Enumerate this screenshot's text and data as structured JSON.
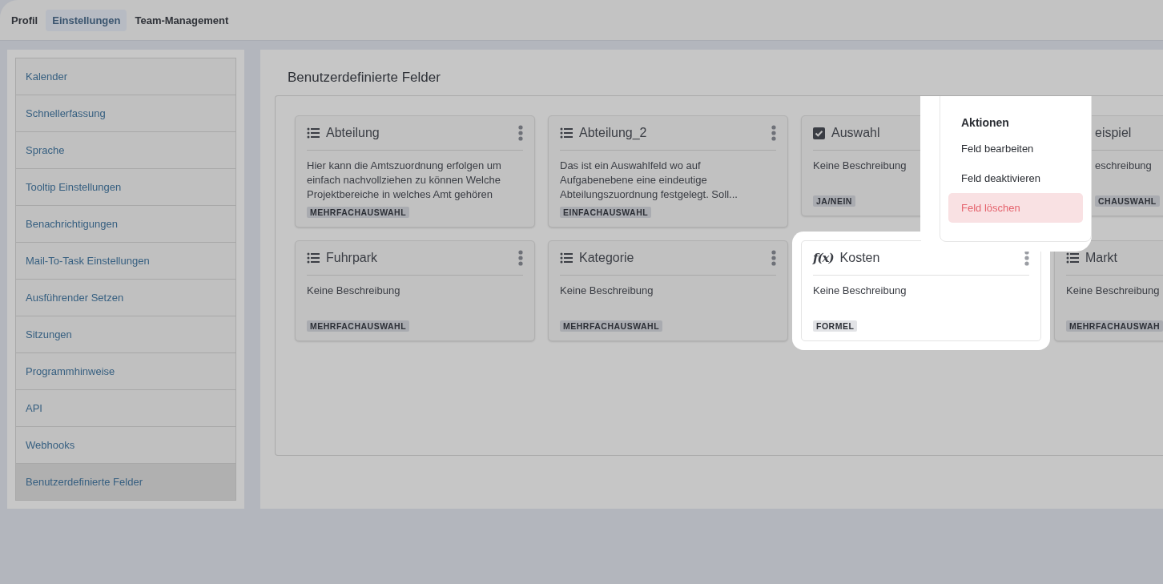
{
  "tabs": [
    {
      "label": "Profil",
      "selected": false
    },
    {
      "label": "Einstellungen",
      "selected": true
    },
    {
      "label": "Team-Management",
      "selected": false
    }
  ],
  "sidebar": {
    "items": [
      {
        "label": "Kalender",
        "selected": false
      },
      {
        "label": "Schnellerfassung",
        "selected": false
      },
      {
        "label": "Sprache",
        "selected": false
      },
      {
        "label": "Tooltip Einstellungen",
        "selected": false
      },
      {
        "label": "Benachrichtigungen",
        "selected": false
      },
      {
        "label": "Mail-To-Task Einstellungen",
        "selected": false
      },
      {
        "label": "Ausführender Setzen",
        "selected": false
      },
      {
        "label": "Sitzungen",
        "selected": false
      },
      {
        "label": "Programmhinweise",
        "selected": false
      },
      {
        "label": "API",
        "selected": false
      },
      {
        "label": "Webhooks",
        "selected": false
      },
      {
        "label": "Benutzerdefinierte Felder",
        "selected": true
      }
    ]
  },
  "section_title": "Benutzerdefinierte Felder",
  "fields": [
    {
      "kind": "list",
      "title": "Abteilung",
      "description": "Hier kann die Amtszuordnung erfolgen um einfach nachvollziehen zu können Welche Projektbereiche in welches Amt gehören",
      "type": "MEHRFACHAUSWAHL",
      "active": false,
      "menu_button": true
    },
    {
      "kind": "list",
      "title": "Abteilung_2",
      "description": "Das ist ein Auswahlfeld wo auf Aufgabenebene eine eindeutige Abteilungszuordnung festgelegt. Soll...",
      "type": "EINFACHAUSWAHL",
      "active": false,
      "menu_button": true
    },
    {
      "kind": "checkbox",
      "title": "Auswahl",
      "description": "Keine Beschreibung",
      "type": "JA/NEIN",
      "active": false,
      "menu_button": false
    },
    {
      "title": "eispiel",
      "description": "eschreibung",
      "type": "CHAUSWAHL",
      "active": false,
      "menu_button": false
    },
    {
      "kind": "list",
      "title": "Fuhrpark",
      "description": "Keine Beschreibung",
      "type": "MEHRFACHAUSWAHL",
      "active": false,
      "menu_button": true
    },
    {
      "kind": "list",
      "title": "Kategorie",
      "description": "Keine Beschreibung",
      "type": "MEHRFACHAUSWAHL",
      "active": false,
      "menu_button": true
    },
    {
      "kind": "formula",
      "icon_glyph": "f(x)",
      "title": "Kosten",
      "description": "Keine Beschreibung",
      "type": "FORMEL",
      "active": true,
      "menu_button": true
    },
    {
      "kind": "list",
      "title": "Markt",
      "description": "Keine Beschreibung",
      "type": "MEHRFACHAUSWAH",
      "active": false,
      "menu_button": false
    }
  ],
  "menu": {
    "items": [
      {
        "kind": "header",
        "label": "Aktionen"
      },
      {
        "kind": "item",
        "label": "Feld bearbeiten",
        "highlighted": false
      },
      {
        "kind": "item",
        "label": "Feld deaktivieren",
        "highlighted": false
      },
      {
        "kind": "danger",
        "label": "Feld löschen",
        "highlighted": true
      }
    ]
  }
}
